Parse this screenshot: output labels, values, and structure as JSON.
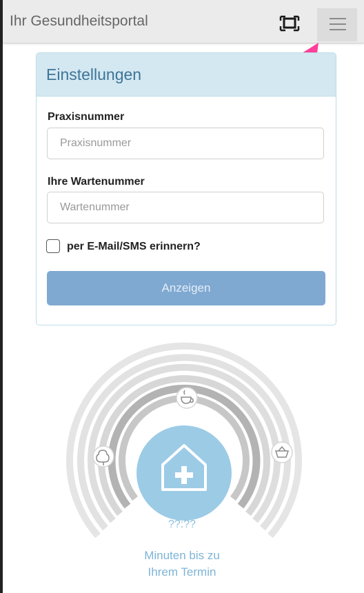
{
  "topbar": {
    "title": "Ihr Gesundheitsportal",
    "fullscreen_icon": "fullscreen-icon",
    "menu_icon": "hamburger-menu-icon"
  },
  "annotation": {
    "icon": "pink-arrow-icon",
    "color": "#ff3f99"
  },
  "settings": {
    "title": "Einstellungen",
    "practice_label": "Praxisnummer",
    "practice_placeholder": "Praxisnummer",
    "practice_value": "",
    "wait_label": "Ihre Wartenummer",
    "wait_placeholder": "Wartenummer",
    "wait_value": "",
    "remind_label": "per E-Mail/SMS erinnern?",
    "remind_checked": false,
    "submit_label": "Anzeigen"
  },
  "status": {
    "time": "??:??",
    "caption_line1": "Minuten bis zu",
    "caption_line2": "Ihrem Termin",
    "icons": [
      "tree-icon",
      "coffee-cup-icon",
      "shopping-basket-icon",
      "home-medical-icon"
    ]
  },
  "colors": {
    "accent": "#80a9d1",
    "panel_header": "#d4e8f2",
    "title_blue": "#3d7597",
    "dial_center": "#9ccbe6"
  }
}
